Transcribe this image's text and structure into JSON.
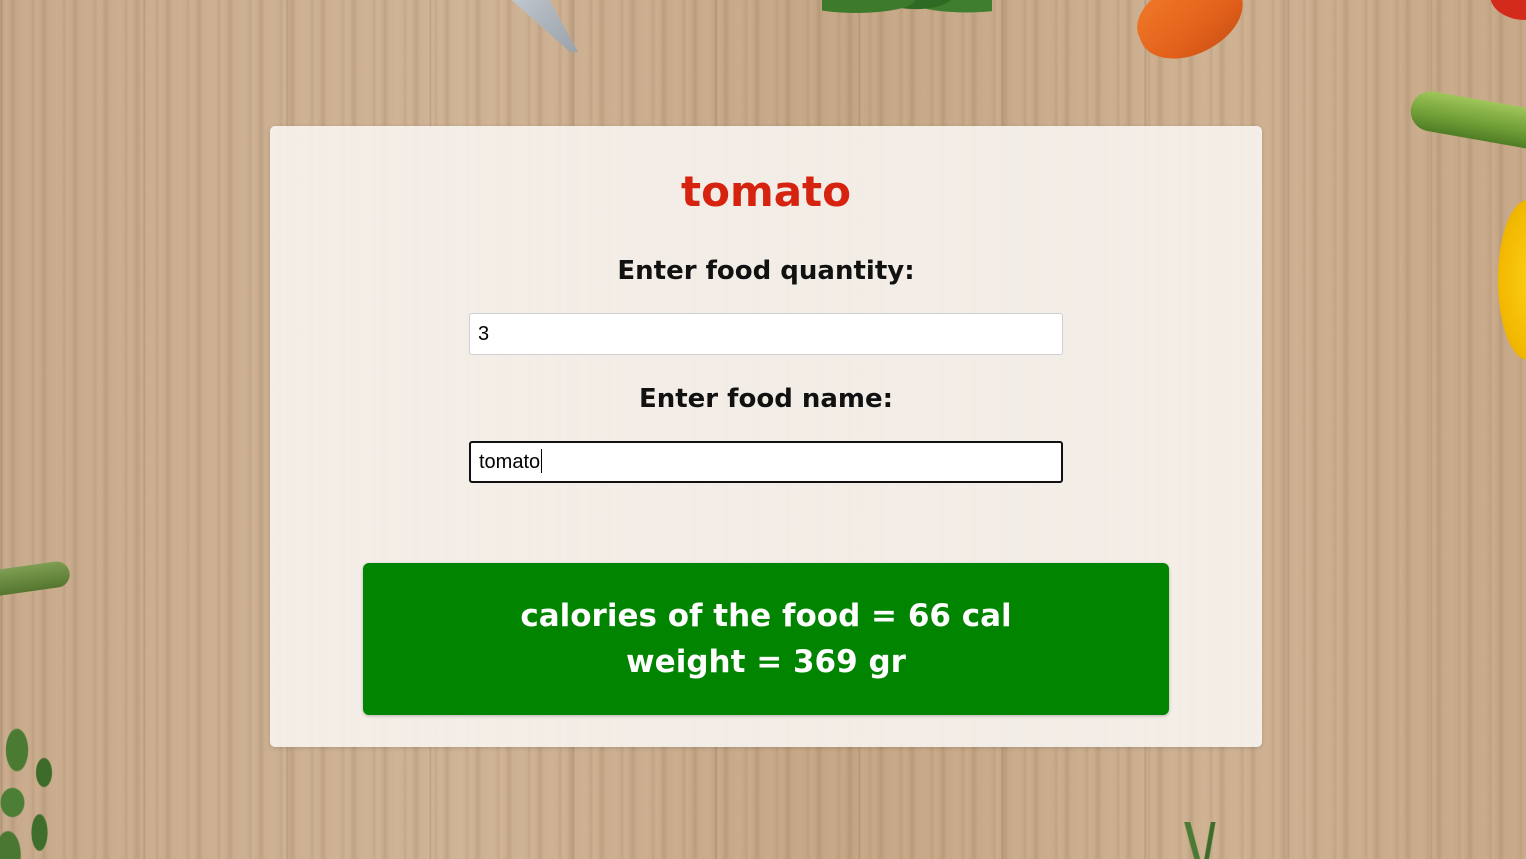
{
  "card": {
    "title": "tomato",
    "quantity_label": "Enter food quantity:",
    "quantity_value": "3",
    "name_label": "Enter food name:",
    "name_value": "tomato"
  },
  "result": {
    "calories_text": "calories of the food = 66 cal",
    "weight_text": "weight = 369 gr"
  },
  "colors": {
    "title": "#d6230f",
    "result_background": "#018500",
    "result_text": "#ffffff"
  },
  "icons": {
    "background_decor": [
      "knife",
      "herb",
      "carrot",
      "tomato",
      "zucchini",
      "yellow-pepper"
    ]
  }
}
